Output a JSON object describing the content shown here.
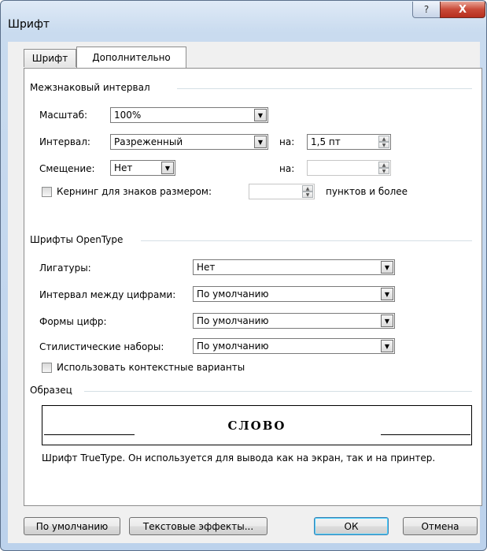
{
  "window": {
    "title": "Шрифт",
    "help_glyph": "?",
    "close_glyph": "X"
  },
  "tabs": [
    {
      "label": "Шрифт",
      "active": false
    },
    {
      "label": "Дополнительно",
      "active": true
    }
  ],
  "spacing": {
    "group_label": "Межзнаковый интервал",
    "scale_label": "Масштаб:",
    "scale_value": "100%",
    "spacing_label": "Интервал:",
    "spacing_value": "Разреженный",
    "spacing_by_label": "на:",
    "spacing_by_value": "1,5 пт",
    "position_label": "Смещение:",
    "position_value": "Нет",
    "position_by_label": "на:",
    "position_by_value": "",
    "kerning_label": "Кернинг для знаков размером:",
    "kerning_value": "",
    "kerning_suffix": "пунктов и более",
    "kerning_checked": false
  },
  "opentype": {
    "group_label": "Шрифты OpenType",
    "ligatures_label": "Лигатуры:",
    "ligatures_value": "Нет",
    "number_spacing_label": "Интервал между цифрами:",
    "number_spacing_value": "По умолчанию",
    "number_forms_label": "Формы цифр:",
    "number_forms_value": "По умолчанию",
    "stylistic_sets_label": "Стилистические наборы:",
    "stylistic_sets_value": "По умолчанию",
    "contextual_label": "Использовать контекстные варианты",
    "contextual_checked": false
  },
  "preview": {
    "group_label": "Образец",
    "sample_text": "СЛОВО",
    "description": "Шрифт TrueType. Он используется для вывода как на экран, так и на принтер."
  },
  "buttons": {
    "default_label": "По умолчанию",
    "text_effects_label": "Текстовые эффекты...",
    "ok_label": "ОК",
    "cancel_label": "Отмена"
  }
}
